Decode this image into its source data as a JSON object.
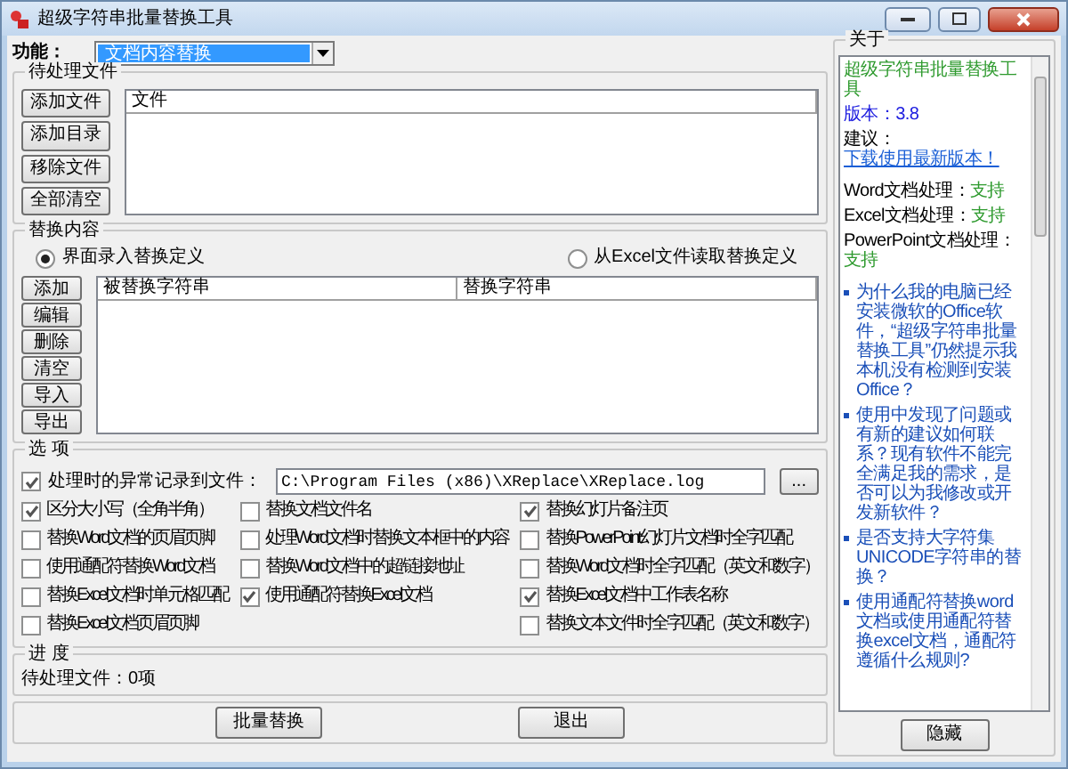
{
  "window": {
    "title": "超级字符串批量替换工具"
  },
  "function": {
    "label": "功能：",
    "value": "文档内容替换"
  },
  "files": {
    "title": "待处理文件",
    "buttons": [
      "添加文件",
      "添加目录",
      "移除文件",
      "全部清空"
    ],
    "columns": [
      "文件"
    ]
  },
  "replace": {
    "title": "替换内容",
    "modes": [
      {
        "label": "界面录入替换定义",
        "selected": true
      },
      {
        "label": "从Excel文件读取替换定义",
        "selected": false
      }
    ],
    "buttons": [
      "添加",
      "编辑",
      "删除",
      "清空",
      "导入",
      "导出"
    ],
    "columns": [
      "被替换字符串",
      "替换字符串"
    ]
  },
  "options": {
    "title": "选 项",
    "log": {
      "label": "处理时的异常记录到文件：",
      "checked": true,
      "path": "C:\\Program Files (x86)\\XReplace\\XReplace.log",
      "browse": "..."
    },
    "columns": [
      [
        {
          "label": "区分大小写（全角半角）",
          "checked": true
        },
        {
          "label": "替换Word文档的页眉页脚",
          "checked": false
        },
        {
          "label": "使用通配符替换Word文档",
          "checked": false
        },
        {
          "label": "替换Excel文档时单元格匹配",
          "checked": false
        },
        {
          "label": "替换Excel文档页眉页脚",
          "checked": false
        }
      ],
      [
        {
          "label": "替换文档文件名",
          "checked": false
        },
        {
          "label": "处理Word文档时替换文本框中的内容",
          "checked": false
        },
        {
          "label": "替换Word文档中的超链接地址",
          "checked": false
        },
        {
          "label": "使用通配符替换Excel文档",
          "checked": true
        }
      ],
      [
        {
          "label": "替换幻灯片备注页",
          "checked": true
        },
        {
          "label": "替换PowerPoint幻灯片文档时全字匹配",
          "checked": false
        },
        {
          "label": "替换Word文档时全字匹配（英文和数字）",
          "checked": false
        },
        {
          "label": "替换Excel文档中工作表名称",
          "checked": true
        },
        {
          "label": "替换文本文件时全字匹配（英文和数字）",
          "checked": false
        }
      ]
    ]
  },
  "progress": {
    "title": "进 度",
    "text": "待处理文件：0项"
  },
  "buttons": [
    "批量替换",
    "退出"
  ],
  "about": {
    "title": "关于",
    "app_name": "超级字符串批量替换工具",
    "version": "版本：3.8",
    "suggest_label": "建议：",
    "suggest_link": "下载使用最新版本！",
    "support": [
      {
        "label": "Word文档处理：",
        "value": "支持"
      },
      {
        "label": "Excel文档处理：",
        "value": "支持"
      },
      {
        "label": "PowerPoint文档处理：",
        "value": "支持"
      }
    ],
    "faq": [
      "为什么我的电脑已经安装微软的Office软件，“超级字符串批量替换工具”仍然提示我本机没有检测到安装Office？",
      "使用中发现了问题或有新的建议如何联系？现有软件不能完全满足我的需求，是否可以为我修改或开发新软件？",
      "是否支持大字符集UNICODE字符串的替换？",
      "使用通配符替换word文档或使用通配符替换excel文档，通配符遵循什么规则?"
    ],
    "hide_button": "隐藏"
  }
}
